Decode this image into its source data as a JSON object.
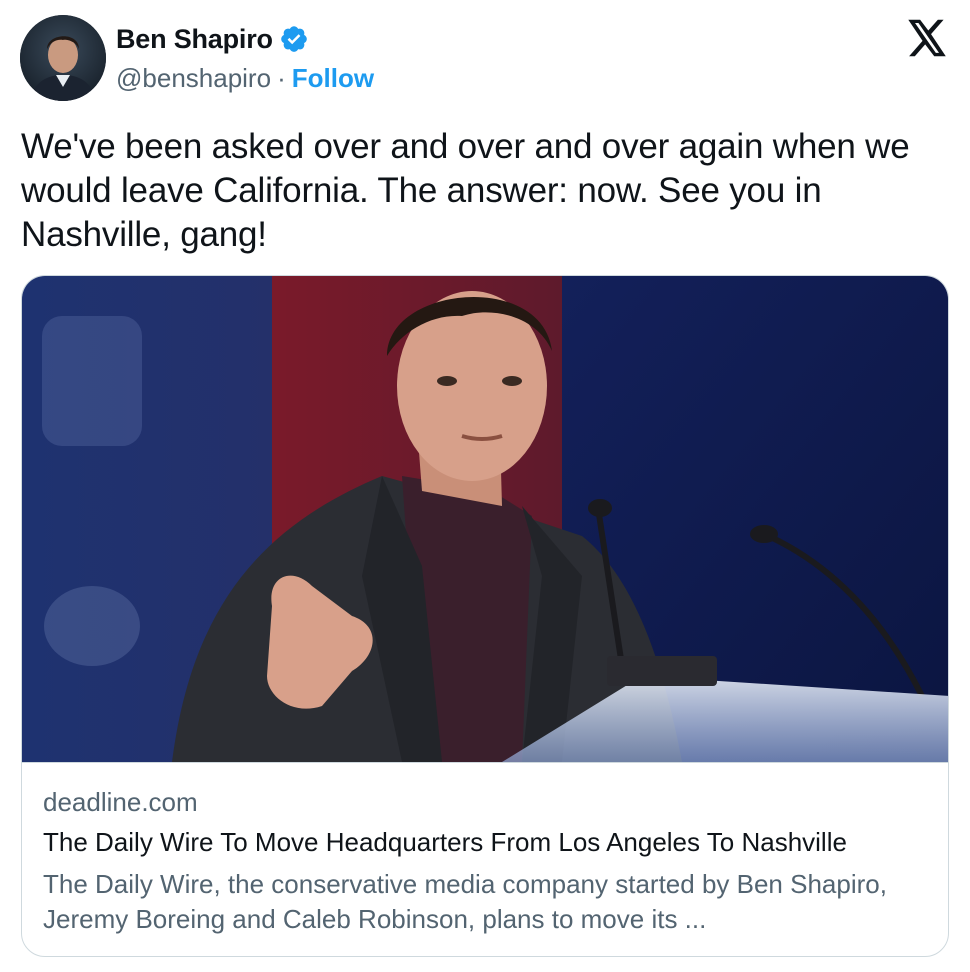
{
  "author": {
    "name": "Ben Shapiro",
    "handle": "@benshapiro",
    "separator": "·",
    "follow_label": "Follow",
    "verified_color": "#1d9bf0"
  },
  "icons": {
    "platform": "x-logo-icon",
    "verified": "verified-badge-icon"
  },
  "tweet": {
    "text": "We've been asked over and over and over again when we would leave California. The answer: now. See you in Nashville, gang!"
  },
  "link_card": {
    "domain": "deadline.com",
    "title": "The Daily Wire To Move Headquarters From Los Angeles To Nashville",
    "description": "The Daily Wire, the conservative media company started by Ben Shapiro, Jeremy Boreing and Caleb Robinson, plans to move its ..."
  },
  "colors": {
    "text_primary": "#0f1419",
    "text_secondary": "#536471",
    "accent": "#1d9bf0",
    "border": "#cfd9de"
  }
}
